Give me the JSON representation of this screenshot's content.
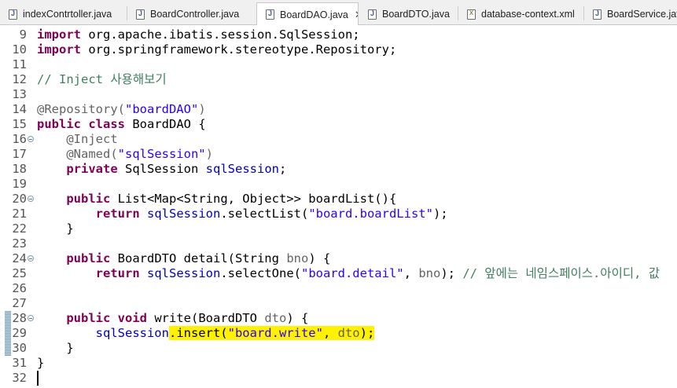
{
  "tabs": [
    {
      "label": "indexContrtoller.java",
      "icon": "java-file-icon",
      "active": false
    },
    {
      "label": "BoardController.java",
      "icon": "java-file-icon",
      "active": false
    },
    {
      "label": "BoardDAO.java",
      "icon": "java-file-icon",
      "active": true,
      "close": "✕"
    },
    {
      "label": "BoardDTO.java",
      "icon": "java-file-icon",
      "active": false
    },
    {
      "label": "database-context.xml",
      "icon": "xml-file-icon",
      "active": false
    },
    {
      "label": "BoardService.java",
      "icon": "java-file-icon",
      "active": false
    }
  ],
  "lines": [
    {
      "n": "9",
      "segs": [
        [
          "kw",
          "import"
        ],
        [
          "",
          "org.apache.ibatis.session.SqlSession;"
        ]
      ]
    },
    {
      "n": "10",
      "segs": [
        [
          "kw",
          "import"
        ],
        [
          "",
          "org.springframework.stereotype.Repository;"
        ]
      ]
    },
    {
      "n": "11",
      "segs": []
    },
    {
      "n": "12",
      "segs": [
        [
          "cm",
          "// Inject 사용해보기"
        ]
      ]
    },
    {
      "n": "13",
      "segs": []
    },
    {
      "n": "14",
      "segs": [
        [
          "ann",
          "@Repository("
        ],
        [
          "str",
          "\"boardDAO\""
        ],
        [
          "ann",
          ")"
        ]
      ]
    },
    {
      "n": "15",
      "segs": [
        [
          "kw",
          "public class"
        ],
        [
          "",
          "BoardDAO {"
        ]
      ]
    },
    {
      "n": "16",
      "fold": true,
      "segs": [
        [
          "ann",
          "    @Inject"
        ]
      ]
    },
    {
      "n": "17",
      "segs": [
        [
          "ann",
          "    @Named("
        ],
        [
          "str",
          "\"sqlSession\""
        ],
        [
          "ann",
          ")"
        ]
      ]
    },
    {
      "n": "18",
      "segs": [
        [
          "kw",
          "    private"
        ],
        [
          "",
          "SqlSession"
        ],
        [
          "fld",
          "sqlSession"
        ],
        [
          "",
          ";"
        ]
      ]
    },
    {
      "n": "19",
      "segs": []
    },
    {
      "n": "20",
      "fold": true,
      "segs": [
        [
          "kw",
          "    public"
        ],
        [
          "",
          "List<Map<String, Object>> boardList(){"
        ]
      ]
    },
    {
      "n": "21",
      "segs": [
        [
          "kw",
          "        return"
        ],
        [
          "fld",
          "sqlSession"
        ],
        [
          "",
          ".selectList("
        ],
        [
          "str",
          "\"board.boardList\""
        ],
        [
          "",
          ");"
        ]
      ]
    },
    {
      "n": "22",
      "segs": [
        [
          "",
          "    }"
        ]
      ]
    },
    {
      "n": "23",
      "segs": []
    },
    {
      "n": "24",
      "fold": true,
      "segs": [
        [
          "kw",
          "    public"
        ],
        [
          "",
          "BoardDTO detail(String"
        ],
        [
          "ann",
          "bno"
        ],
        [
          "",
          ") {"
        ]
      ]
    },
    {
      "n": "25",
      "segs": [
        [
          "kw",
          "        return"
        ],
        [
          "fld",
          "sqlSession"
        ],
        [
          "",
          ".selectOne("
        ],
        [
          "str",
          "\"board.detail\""
        ],
        [
          "",
          ", "
        ],
        [
          "ann",
          "bno"
        ],
        [
          "",
          "); "
        ],
        [
          "cm",
          "// 앞에는 네임스페이스.아이디, 값"
        ]
      ]
    },
    {
      "n": "26",
      "segs": []
    },
    {
      "n": "27",
      "segs": []
    },
    {
      "n": "28",
      "fold": true,
      "segs": [
        [
          "kw",
          "    public void"
        ],
        [
          "",
          "write(BoardDTO"
        ],
        [
          "ann",
          "dto"
        ],
        [
          "",
          ") {"
        ]
      ]
    },
    {
      "n": "29",
      "segs": [
        [
          "fld",
          "        sqlSession"
        ],
        [
          "hl",
          ".insert("
        ],
        [
          "hlstr",
          "\"board.write\""
        ],
        [
          "hl",
          ", "
        ],
        [
          "hlann",
          "dto"
        ],
        [
          "hl",
          ");"
        ]
      ]
    },
    {
      "n": "30",
      "segs": [
        [
          "",
          "    }"
        ]
      ]
    },
    {
      "n": "31",
      "segs": [
        [
          "",
          "}"
        ]
      ]
    },
    {
      "n": "32",
      "segs": [],
      "caret": true
    }
  ]
}
